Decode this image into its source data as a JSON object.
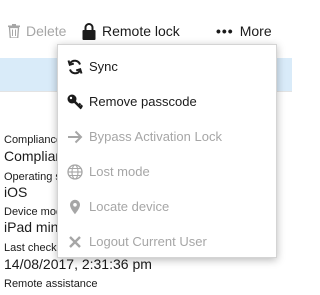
{
  "toolbar": {
    "delete_label": "Delete",
    "remote_lock_label": "Remote lock",
    "more_dots": "•••",
    "more_label": "More"
  },
  "properties": [
    {
      "label": "Compliance",
      "value": "Complian"
    },
    {
      "label": "Operating s",
      "value": "iOS"
    },
    {
      "label": "Device mod",
      "value": "iPad mini"
    },
    {
      "label": "Last check-",
      "value": "14/08/2017, 2:31:36 pm"
    },
    {
      "label": "Remote assistance",
      "value": ""
    }
  ],
  "menu": {
    "items": [
      {
        "label": "Sync",
        "icon": "sync-icon",
        "enabled": true
      },
      {
        "label": "Remove passcode",
        "icon": "key-icon",
        "enabled": true
      },
      {
        "label": "Bypass Activation Lock",
        "icon": "arrow-right-icon",
        "enabled": false
      },
      {
        "label": "Lost mode",
        "icon": "globe-icon",
        "enabled": false
      },
      {
        "label": "Locate device",
        "icon": "location-pin-icon",
        "enabled": false
      },
      {
        "label": "Logout Current User",
        "icon": "x-icon",
        "enabled": false
      }
    ]
  },
  "colors": {
    "accent_band": "#d9ebf9",
    "disabled_text": "#a6a6a6",
    "enabled_text": "#1b1b1b"
  }
}
